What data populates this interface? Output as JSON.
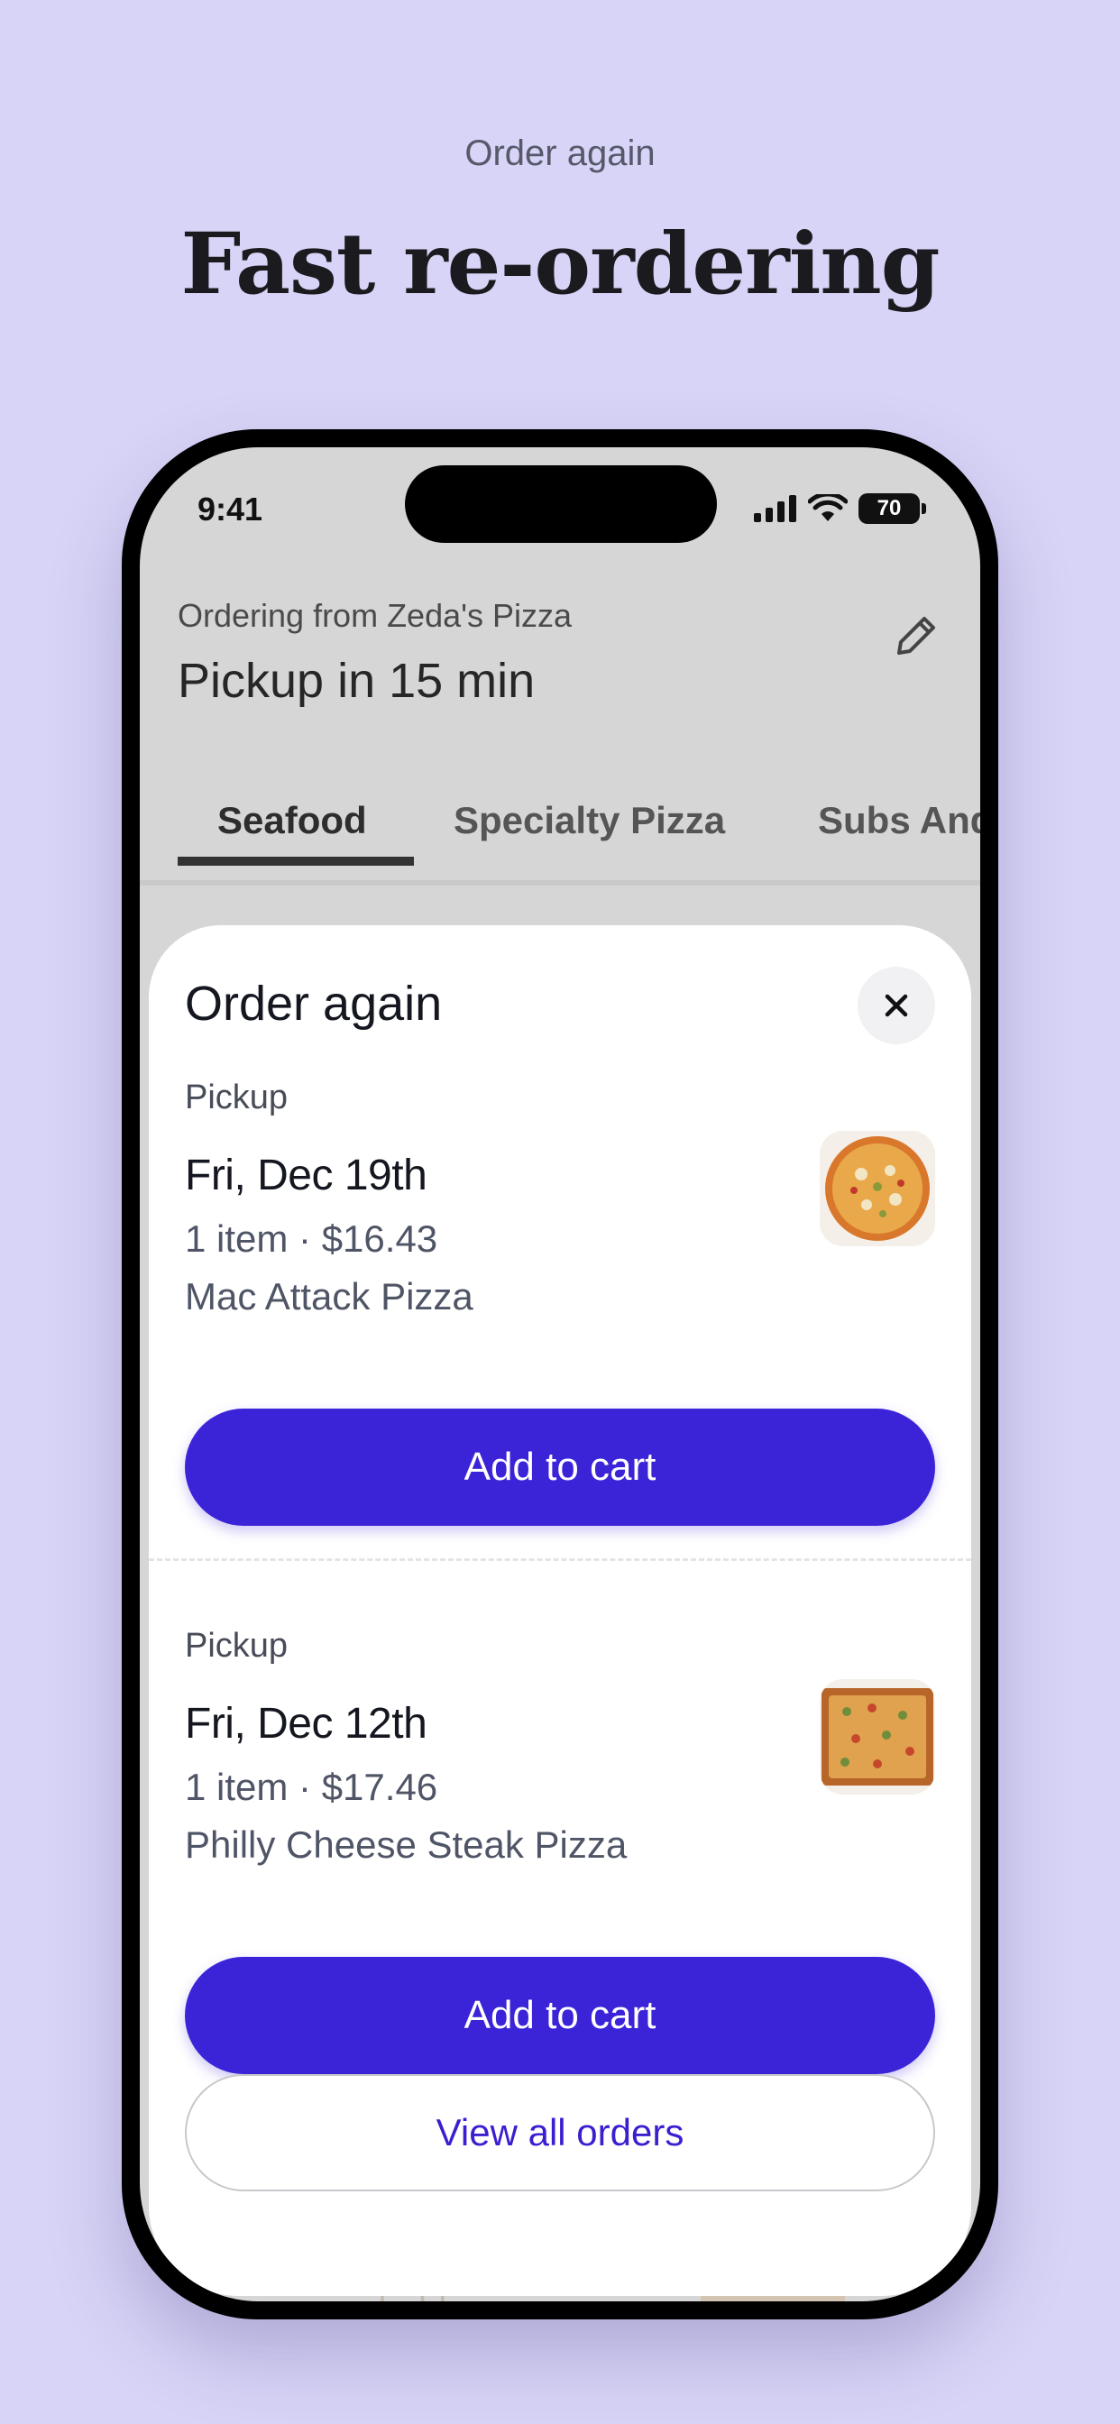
{
  "intro": {
    "eyebrow": "Order again",
    "headline": "Fast re-ordering"
  },
  "status_bar": {
    "time": "9:41",
    "battery": "70",
    "icons": [
      "signal-icon",
      "wifi-icon",
      "battery-icon"
    ]
  },
  "header": {
    "ordering_from": "Ordering from Zeda's Pizza",
    "pickup_time": "Pickup in 15 min",
    "edit_icon": "pencil-icon"
  },
  "tabs": [
    {
      "label": "Seafood",
      "active": true
    },
    {
      "label": "Specialty Pizza",
      "active": false
    },
    {
      "label": "Subs And",
      "active": false
    }
  ],
  "sheet": {
    "title": "Order again",
    "close_icon": "close-icon",
    "orders": [
      {
        "type": "Pickup",
        "date": "Fri, Dec 19th",
        "meta": "1 item · $16.43",
        "item_name": "Mac Attack Pizza",
        "button": "Add to cart"
      },
      {
        "type": "Pickup",
        "date": "Fri, Dec 12th",
        "meta": "1 item · $17.46",
        "item_name": "Philly Cheese Steak Pizza",
        "button": "Add to cart"
      }
    ],
    "view_all": "View all orders"
  },
  "colors": {
    "background": "#d8d4f7",
    "accent": "#3b24d8",
    "link": "#3a1fd0"
  }
}
